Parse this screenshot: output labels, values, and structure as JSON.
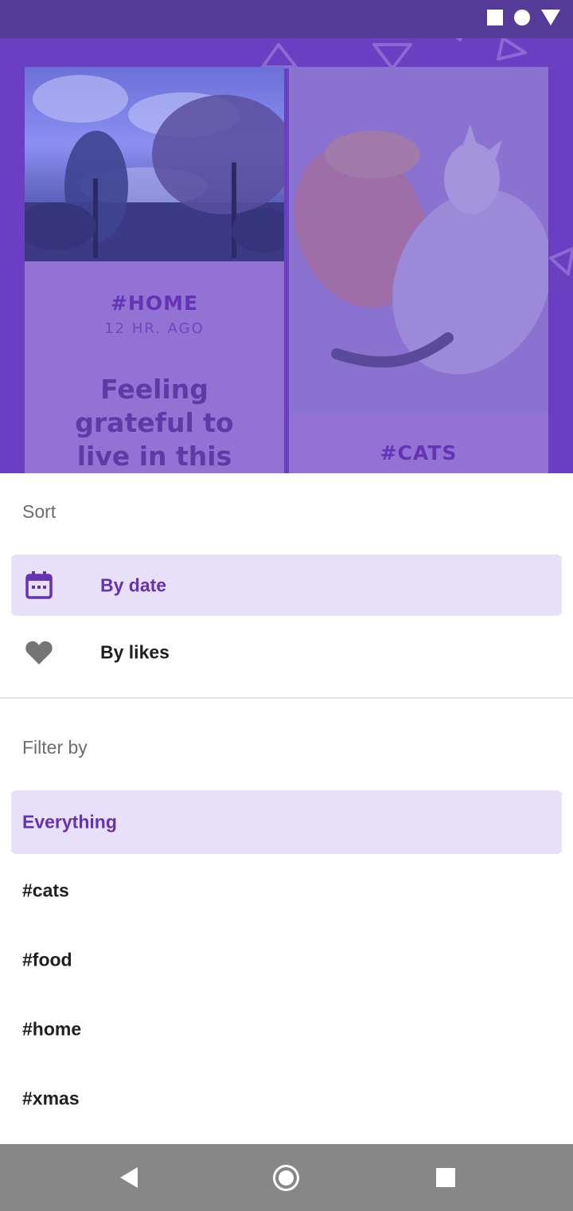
{
  "status_bar": {
    "icons": [
      "square-icon",
      "circle-icon",
      "triangle-icon"
    ]
  },
  "background_feed": {
    "cards": [
      {
        "tag": "#HOME",
        "time": "12 HR. AGO",
        "quote": "Feeling grateful to live in this"
      },
      {
        "tag": "#CATS"
      }
    ]
  },
  "sheet": {
    "sort": {
      "label": "Sort",
      "options": [
        {
          "label": "By date",
          "icon": "calendar-icon",
          "selected": true
        },
        {
          "label": "By likes",
          "icon": "heart-icon",
          "selected": false
        }
      ]
    },
    "filter": {
      "label": "Filter by",
      "options": [
        {
          "label": "Everything",
          "selected": true
        },
        {
          "label": "#cats",
          "selected": false
        },
        {
          "label": "#food",
          "selected": false
        },
        {
          "label": "#home",
          "selected": false
        },
        {
          "label": "#xmas",
          "selected": false
        }
      ]
    }
  },
  "nav_bar": {
    "buttons": [
      "back-icon",
      "home-icon",
      "recents-icon"
    ]
  },
  "colors": {
    "accent": "#6432b3",
    "selected_bg": "#e8dff8",
    "app_bg": "#6a3fc2",
    "status_bar": "#553b97",
    "nav_bar": "#878787"
  }
}
